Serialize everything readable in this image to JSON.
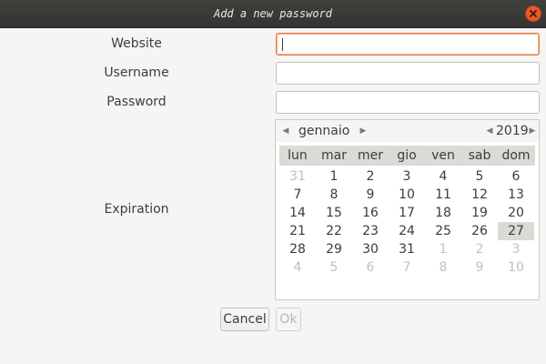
{
  "window": {
    "title": "Add a new password",
    "close_icon": "close-icon"
  },
  "form": {
    "website_label": "Website",
    "username_label": "Username",
    "password_label": "Password",
    "expiration_label": "Expiration",
    "website_value": "",
    "username_value": "",
    "password_value": ""
  },
  "calendar": {
    "month": "gennaio",
    "year": "2019",
    "day_names": [
      "lun",
      "mar",
      "mer",
      "gio",
      "ven",
      "sab",
      "dom"
    ],
    "weeks": [
      [
        {
          "d": "31",
          "o": true
        },
        {
          "d": "1"
        },
        {
          "d": "2"
        },
        {
          "d": "3"
        },
        {
          "d": "4"
        },
        {
          "d": "5"
        },
        {
          "d": "6"
        }
      ],
      [
        {
          "d": "7"
        },
        {
          "d": "8"
        },
        {
          "d": "9"
        },
        {
          "d": "10"
        },
        {
          "d": "11"
        },
        {
          "d": "12"
        },
        {
          "d": "13"
        }
      ],
      [
        {
          "d": "14"
        },
        {
          "d": "15"
        },
        {
          "d": "16"
        },
        {
          "d": "17"
        },
        {
          "d": "18"
        },
        {
          "d": "19"
        },
        {
          "d": "20"
        }
      ],
      [
        {
          "d": "21"
        },
        {
          "d": "22"
        },
        {
          "d": "23"
        },
        {
          "d": "24"
        },
        {
          "d": "25"
        },
        {
          "d": "26"
        },
        {
          "d": "27",
          "s": true
        }
      ],
      [
        {
          "d": "28"
        },
        {
          "d": "29"
        },
        {
          "d": "30"
        },
        {
          "d": "31"
        },
        {
          "d": "1",
          "o": true
        },
        {
          "d": "2",
          "o": true
        },
        {
          "d": "3",
          "o": true
        }
      ],
      [
        {
          "d": "4",
          "o": true
        },
        {
          "d": "5",
          "o": true
        },
        {
          "d": "6",
          "o": true
        },
        {
          "d": "7",
          "o": true
        },
        {
          "d": "8",
          "o": true
        },
        {
          "d": "9",
          "o": true
        },
        {
          "d": "10",
          "o": true
        }
      ]
    ],
    "selected_day": "27"
  },
  "buttons": {
    "cancel_label": "Cancel",
    "ok_label": "Ok"
  },
  "colors": {
    "accent": "#e9773c",
    "close_button": "#e9582a",
    "titlebar": "#3a3936"
  }
}
